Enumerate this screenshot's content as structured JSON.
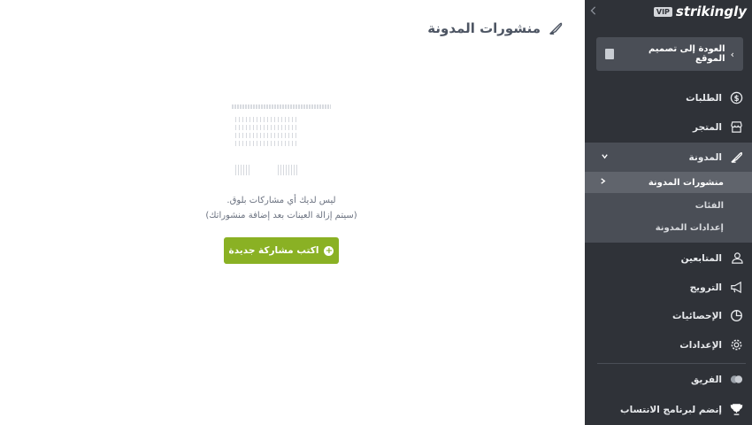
{
  "main": {
    "page_title": "منشورات المدونة",
    "empty_line1": "ليس لديك أي مشاركات بلوق.",
    "empty_line2": "(سيتم إزالة العينات بعد إضافة منشوراتك)",
    "new_post_label": "اكتب مشاركة جديدة"
  },
  "sidebar": {
    "logo_text": "strikingly",
    "vip_label": "VIP",
    "back_label": "العودة إلى تصميم الموقع",
    "items": [
      {
        "label": "الطلبات",
        "icon": "dollar-circle-icon"
      },
      {
        "label": "المتجر",
        "icon": "store-icon"
      },
      {
        "label": "المدونة",
        "icon": "quill-icon"
      },
      {
        "label": "المتابعين",
        "icon": "people-icon"
      },
      {
        "label": "الترويج",
        "icon": "megaphone-icon"
      },
      {
        "label": "الإحصائيات",
        "icon": "pie-chart-icon"
      },
      {
        "label": "الإعدادات",
        "icon": "gear-icon"
      },
      {
        "label": "الفريق",
        "icon": "team-icon"
      },
      {
        "label": "إنضم لبرنامج الانتساب",
        "icon": "trophy-icon"
      }
    ],
    "blog_sub": [
      {
        "label": "منشورات المدونة"
      },
      {
        "label": "الفئات"
      },
      {
        "label": "إعدادات المدونة"
      }
    ]
  },
  "colors": {
    "accent_green": "#8ab124",
    "sidebar_bg": "#2f3238",
    "sidebar_active": "#4a4e56"
  }
}
